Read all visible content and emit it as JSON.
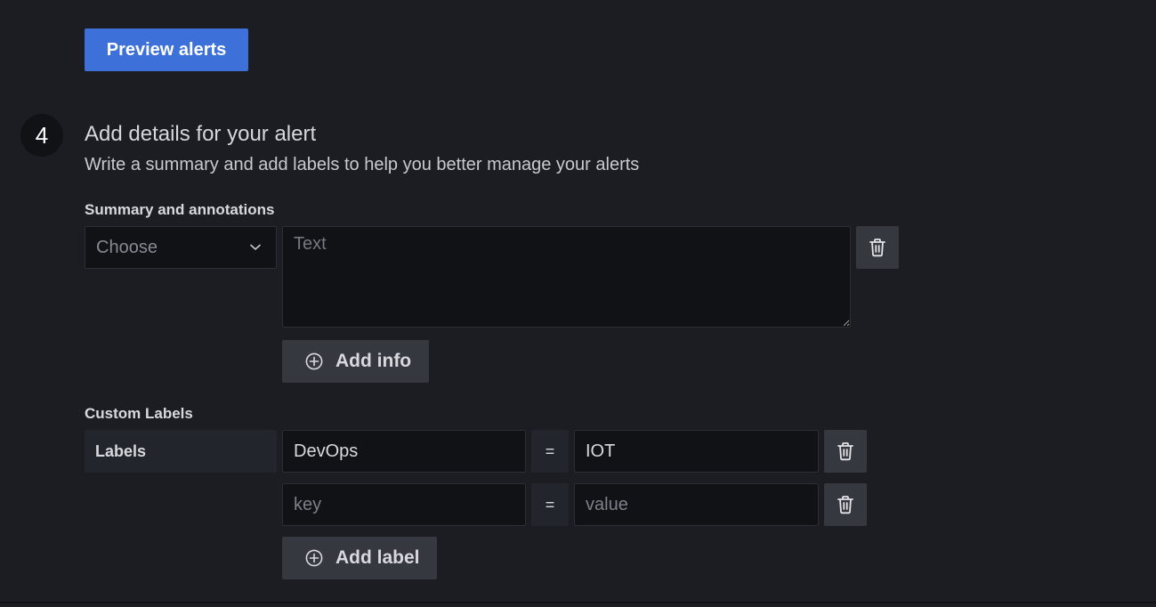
{
  "preview": {
    "button_label": "Preview alerts"
  },
  "step": {
    "number": "4",
    "title": "Add details for your alert",
    "subtitle": "Write a summary and add labels to help you better manage your alerts"
  },
  "annotations": {
    "section_label": "Summary and annotations",
    "select_placeholder": "Choose",
    "text_placeholder": "Text",
    "add_info_label": "Add info"
  },
  "custom_labels": {
    "section_label": "Custom Labels",
    "labels_caption": "Labels",
    "rows": [
      {
        "key": "DevOps",
        "operator": "=",
        "value": "IOT"
      },
      {
        "key": "",
        "operator": "=",
        "value": ""
      }
    ],
    "key_placeholder": "key",
    "value_placeholder": "value",
    "add_label_label": "Add label"
  },
  "icons": {
    "delete": "trash-icon",
    "add": "plus-circle-icon",
    "dropdown": "chevron-down-icon"
  },
  "colors": {
    "background": "#1b1d22",
    "primary_button": "#3d71d9",
    "secondary_button": "#35383f",
    "input_background": "#111216"
  }
}
